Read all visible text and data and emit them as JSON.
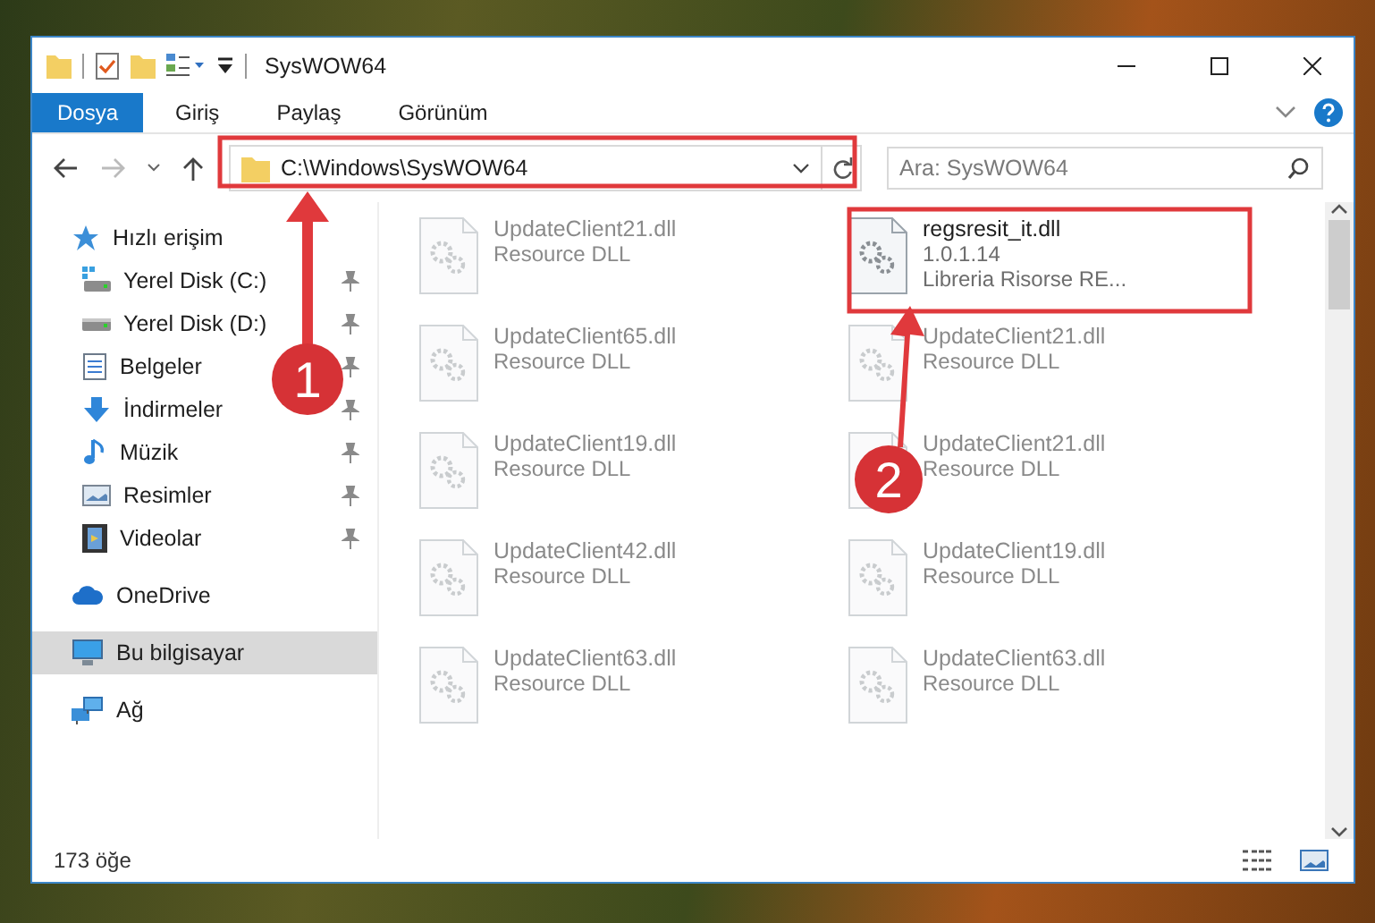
{
  "window": {
    "title": "SysWOW64"
  },
  "ribbon_tabs": [
    {
      "label": "Dosya",
      "selected": true
    },
    {
      "label": "Giriş",
      "selected": false
    },
    {
      "label": "Paylaş",
      "selected": false
    },
    {
      "label": "Görünüm",
      "selected": false
    }
  ],
  "address_bar": {
    "path": "C:\\Windows\\SysWOW64"
  },
  "search": {
    "placeholder": "Ara: SysWOW64"
  },
  "nav_pane": [
    {
      "label": "Hızlı erişim",
      "kind": "star",
      "pinned": false,
      "selected": false,
      "children": [
        {
          "label": "Yerel Disk (C:)",
          "kind": "system-drive",
          "pinned": true,
          "selected": false
        },
        {
          "label": "Yerel Disk (D:)",
          "kind": "drive",
          "pinned": true,
          "selected": false
        },
        {
          "label": "Belgeler",
          "kind": "document",
          "pinned": true,
          "selected": false
        },
        {
          "label": "İndirmeler",
          "kind": "download",
          "pinned": true,
          "selected": false
        },
        {
          "label": "Müzik",
          "kind": "music",
          "pinned": true,
          "selected": false
        },
        {
          "label": "Resimler",
          "kind": "picture",
          "pinned": true,
          "selected": false
        },
        {
          "label": "Videolar",
          "kind": "video",
          "pinned": true,
          "selected": false
        }
      ]
    },
    {
      "label": "OneDrive",
      "kind": "cloud",
      "pinned": false,
      "selected": false
    },
    {
      "label": "Bu bilgisayar",
      "kind": "computer",
      "pinned": false,
      "selected": true
    },
    {
      "label": "Ağ",
      "kind": "network",
      "pinned": false,
      "selected": false
    }
  ],
  "files": [
    {
      "name": "UpdateClient21.dll",
      "details": [
        "Resource DLL"
      ],
      "kind": "faded"
    },
    {
      "name": "regsresit_it.dll",
      "details": [
        "1.0.1.14",
        "Libreria Risorse RE..."
      ],
      "kind": "highlighted"
    },
    {
      "name": "UpdateClient65.dll",
      "details": [
        "Resource DLL"
      ],
      "kind": "faded"
    },
    {
      "name": "UpdateClient21.dll",
      "details": [
        "Resource DLL"
      ],
      "kind": "faded"
    },
    {
      "name": "UpdateClient19.dll",
      "details": [
        "Resource DLL"
      ],
      "kind": "faded"
    },
    {
      "name": "UpdateClient21.dll",
      "details": [
        "Resource DLL"
      ],
      "kind": "faded"
    },
    {
      "name": "UpdateClient42.dll",
      "details": [
        "Resource DLL"
      ],
      "kind": "faded"
    },
    {
      "name": "UpdateClient19.dll",
      "details": [
        "Resource DLL"
      ],
      "kind": "faded"
    },
    {
      "name": "UpdateClient63.dll",
      "details": [
        "Resource DLL"
      ],
      "kind": "faded"
    },
    {
      "name": "UpdateClient63.dll",
      "details": [
        "Resource DLL"
      ],
      "kind": "faded"
    }
  ],
  "status_bar": {
    "item_count": "173 öğe"
  },
  "annotations": [
    {
      "number": "1"
    },
    {
      "number": "2"
    }
  ]
}
